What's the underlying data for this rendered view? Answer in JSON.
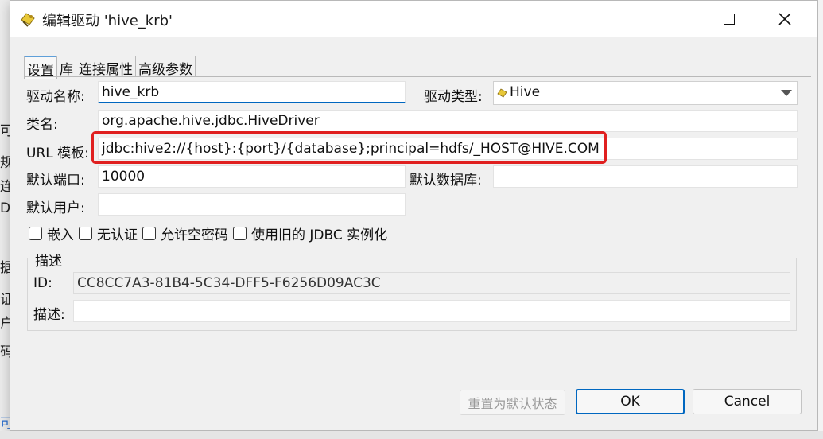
{
  "window": {
    "title": "编辑驱动 'hive_krb'"
  },
  "background_window": {
    "fragments": [
      "可",
      "规",
      "连",
      "DI",
      "据",
      "证",
      "户",
      "码",
      "可"
    ]
  },
  "tabs": [
    {
      "label": "设置",
      "active": true
    },
    {
      "label": "库",
      "active": false
    },
    {
      "label": "连接属性",
      "active": false
    },
    {
      "label": "高级参数",
      "active": false
    }
  ],
  "settings": {
    "driver_name_label": "驱动名称:",
    "driver_name_value": "hive_krb",
    "driver_type_label": "驱动类型:",
    "driver_type_value": "Hive",
    "class_name_label": "类名:",
    "class_name_value": "org.apache.hive.jdbc.HiveDriver",
    "url_template_label": "URL 模板:",
    "url_template_value": "jdbc:hive2://{host}:{port}/{database};principal=hdfs/_HOST@HIVE.COM",
    "default_port_label": "默认端口:",
    "default_port_value": "10000",
    "default_database_label": "默认数据库:",
    "default_database_value": "",
    "default_user_label": "默认用户:",
    "default_user_value": ""
  },
  "checkboxes": [
    {
      "label": "嵌入",
      "checked": false
    },
    {
      "label": "无认证",
      "checked": false
    },
    {
      "label": "允许空密码",
      "checked": false
    },
    {
      "label": "使用旧的 JDBC 实例化",
      "checked": false
    }
  ],
  "description_group": {
    "title": "描述",
    "id_label": "ID:",
    "id_value": "CC8CC7A3-81B4-5C34-DFF5-F6256D09AC3C",
    "desc_label": "描述:",
    "desc_value": ""
  },
  "buttons": {
    "reset": "重置为默认状态",
    "ok": "OK",
    "cancel": "Cancel"
  },
  "colors": {
    "accent": "#0067c0",
    "highlight": "#e02020",
    "tab_active": "#5e9fd9"
  },
  "icons": {
    "title": "driver-icon",
    "maximize": "maximize-icon",
    "close": "close-icon"
  }
}
